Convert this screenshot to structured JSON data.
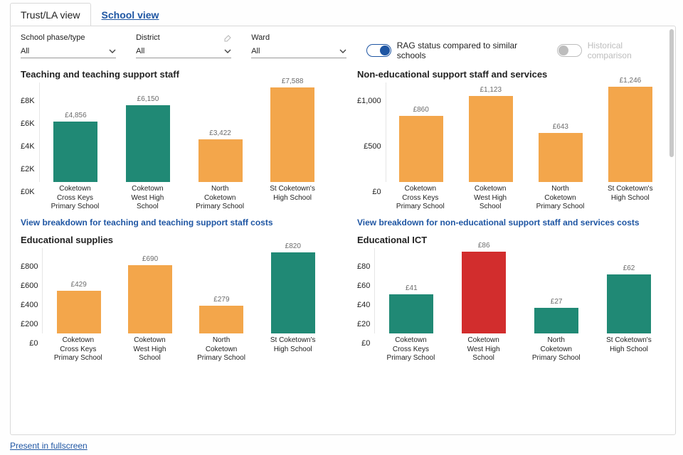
{
  "tabs": {
    "trust": "Trust/LA view",
    "school": "School view"
  },
  "filters": {
    "phase": {
      "label": "School phase/type",
      "value": "All"
    },
    "district": {
      "label": "District",
      "value": "All"
    },
    "ward": {
      "label": "Ward",
      "value": "All"
    }
  },
  "toggles": {
    "rag": "RAG status compared to similar schools",
    "hist": "Historical comparison"
  },
  "categories": [
    "Coketown Cross Keys Primary School",
    "Coketown West High School",
    "North Coketown Primary School",
    "St Coketown's High School"
  ],
  "colors": {
    "green": "#208975",
    "amber": "#f3a64b",
    "red": "#d22d2d"
  },
  "footer_link": "Present in fullscreen",
  "chart_data": [
    {
      "id": "teaching",
      "type": "bar",
      "title": "Teaching and teaching support staff",
      "link": "View breakdown for teaching and teaching support staff costs",
      "yticks": [
        "£8K",
        "£6K",
        "£4K",
        "£2K",
        "£0K"
      ],
      "ylim": [
        0,
        8000
      ],
      "values": [
        4856,
        6150,
        3422,
        7588
      ],
      "labels": [
        "£4,856",
        "£6,150",
        "£3,422",
        "£7,588"
      ],
      "rag": [
        "green",
        "green",
        "amber",
        "amber"
      ]
    },
    {
      "id": "non_ed_support",
      "type": "bar",
      "title": "Non-educational support staff and services",
      "link": "View breakdown for non-educational support staff and services costs",
      "yticks": [
        "£1,000",
        "£500",
        "£0"
      ],
      "ylim": [
        0,
        1300
      ],
      "values": [
        860,
        1123,
        643,
        1246
      ],
      "labels": [
        "£860",
        "£1,123",
        "£643",
        "£1,246"
      ],
      "rag": [
        "amber",
        "amber",
        "amber",
        "amber"
      ]
    },
    {
      "id": "ed_supplies",
      "type": "bar",
      "title": "Educational supplies",
      "yticks": [
        "£800",
        "£600",
        "£400",
        "£200",
        "£0"
      ],
      "ylim": [
        0,
        860
      ],
      "values": [
        429,
        690,
        279,
        820
      ],
      "labels": [
        "£429",
        "£690",
        "£279",
        "£820"
      ],
      "rag": [
        "amber",
        "amber",
        "amber",
        "green"
      ]
    },
    {
      "id": "ed_ict",
      "type": "bar",
      "title": "Educational ICT",
      "yticks": [
        "£80",
        "£60",
        "£40",
        "£20",
        "£0"
      ],
      "ylim": [
        0,
        90
      ],
      "values": [
        41,
        86,
        27,
        62
      ],
      "labels": [
        "£41",
        "£86",
        "£27",
        "£62"
      ],
      "rag": [
        "green",
        "red",
        "green",
        "green"
      ]
    }
  ]
}
